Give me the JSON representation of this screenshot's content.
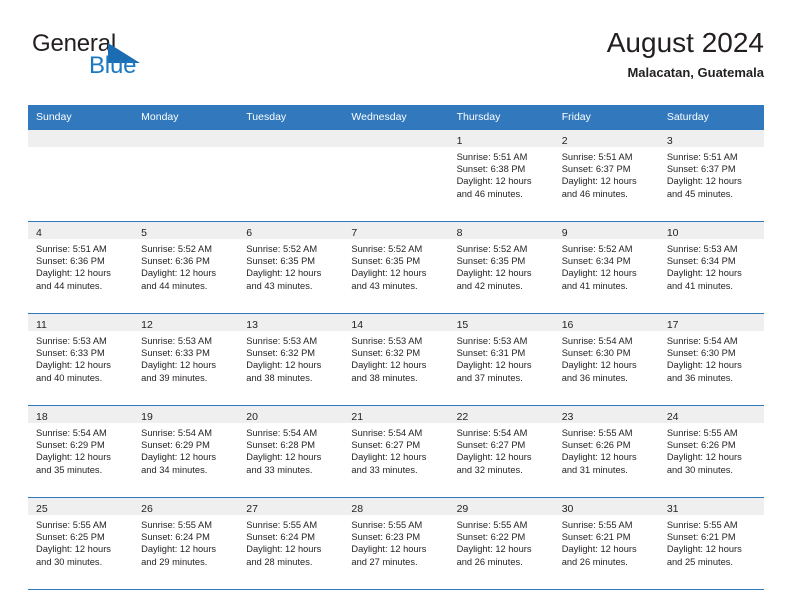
{
  "brand": {
    "name_part1": "General",
    "name_part2": "Blue",
    "triangle_color": "#1b6cb0",
    "blue_color": "#1b79c3"
  },
  "header": {
    "title": "August 2024",
    "subtitle": "Malacatan, Guatemala",
    "accent_color": "#3179bc",
    "daynum_band_color": "#efefef"
  },
  "weekdays": [
    "Sunday",
    "Monday",
    "Tuesday",
    "Wednesday",
    "Thursday",
    "Friday",
    "Saturday"
  ],
  "weeks": [
    [
      {
        "day": "",
        "sunrise": "",
        "sunset": "",
        "daylight1": "",
        "daylight2": ""
      },
      {
        "day": "",
        "sunrise": "",
        "sunset": "",
        "daylight1": "",
        "daylight2": ""
      },
      {
        "day": "",
        "sunrise": "",
        "sunset": "",
        "daylight1": "",
        "daylight2": ""
      },
      {
        "day": "",
        "sunrise": "",
        "sunset": "",
        "daylight1": "",
        "daylight2": ""
      },
      {
        "day": "1",
        "sunrise": "Sunrise: 5:51 AM",
        "sunset": "Sunset: 6:38 PM",
        "daylight1": "Daylight: 12 hours",
        "daylight2": "and 46 minutes."
      },
      {
        "day": "2",
        "sunrise": "Sunrise: 5:51 AM",
        "sunset": "Sunset: 6:37 PM",
        "daylight1": "Daylight: 12 hours",
        "daylight2": "and 46 minutes."
      },
      {
        "day": "3",
        "sunrise": "Sunrise: 5:51 AM",
        "sunset": "Sunset: 6:37 PM",
        "daylight1": "Daylight: 12 hours",
        "daylight2": "and 45 minutes."
      }
    ],
    [
      {
        "day": "4",
        "sunrise": "Sunrise: 5:51 AM",
        "sunset": "Sunset: 6:36 PM",
        "daylight1": "Daylight: 12 hours",
        "daylight2": "and 44 minutes."
      },
      {
        "day": "5",
        "sunrise": "Sunrise: 5:52 AM",
        "sunset": "Sunset: 6:36 PM",
        "daylight1": "Daylight: 12 hours",
        "daylight2": "and 44 minutes."
      },
      {
        "day": "6",
        "sunrise": "Sunrise: 5:52 AM",
        "sunset": "Sunset: 6:35 PM",
        "daylight1": "Daylight: 12 hours",
        "daylight2": "and 43 minutes."
      },
      {
        "day": "7",
        "sunrise": "Sunrise: 5:52 AM",
        "sunset": "Sunset: 6:35 PM",
        "daylight1": "Daylight: 12 hours",
        "daylight2": "and 43 minutes."
      },
      {
        "day": "8",
        "sunrise": "Sunrise: 5:52 AM",
        "sunset": "Sunset: 6:35 PM",
        "daylight1": "Daylight: 12 hours",
        "daylight2": "and 42 minutes."
      },
      {
        "day": "9",
        "sunrise": "Sunrise: 5:52 AM",
        "sunset": "Sunset: 6:34 PM",
        "daylight1": "Daylight: 12 hours",
        "daylight2": "and 41 minutes."
      },
      {
        "day": "10",
        "sunrise": "Sunrise: 5:53 AM",
        "sunset": "Sunset: 6:34 PM",
        "daylight1": "Daylight: 12 hours",
        "daylight2": "and 41 minutes."
      }
    ],
    [
      {
        "day": "11",
        "sunrise": "Sunrise: 5:53 AM",
        "sunset": "Sunset: 6:33 PM",
        "daylight1": "Daylight: 12 hours",
        "daylight2": "and 40 minutes."
      },
      {
        "day": "12",
        "sunrise": "Sunrise: 5:53 AM",
        "sunset": "Sunset: 6:33 PM",
        "daylight1": "Daylight: 12 hours",
        "daylight2": "and 39 minutes."
      },
      {
        "day": "13",
        "sunrise": "Sunrise: 5:53 AM",
        "sunset": "Sunset: 6:32 PM",
        "daylight1": "Daylight: 12 hours",
        "daylight2": "and 38 minutes."
      },
      {
        "day": "14",
        "sunrise": "Sunrise: 5:53 AM",
        "sunset": "Sunset: 6:32 PM",
        "daylight1": "Daylight: 12 hours",
        "daylight2": "and 38 minutes."
      },
      {
        "day": "15",
        "sunrise": "Sunrise: 5:53 AM",
        "sunset": "Sunset: 6:31 PM",
        "daylight1": "Daylight: 12 hours",
        "daylight2": "and 37 minutes."
      },
      {
        "day": "16",
        "sunrise": "Sunrise: 5:54 AM",
        "sunset": "Sunset: 6:30 PM",
        "daylight1": "Daylight: 12 hours",
        "daylight2": "and 36 minutes."
      },
      {
        "day": "17",
        "sunrise": "Sunrise: 5:54 AM",
        "sunset": "Sunset: 6:30 PM",
        "daylight1": "Daylight: 12 hours",
        "daylight2": "and 36 minutes."
      }
    ],
    [
      {
        "day": "18",
        "sunrise": "Sunrise: 5:54 AM",
        "sunset": "Sunset: 6:29 PM",
        "daylight1": "Daylight: 12 hours",
        "daylight2": "and 35 minutes."
      },
      {
        "day": "19",
        "sunrise": "Sunrise: 5:54 AM",
        "sunset": "Sunset: 6:29 PM",
        "daylight1": "Daylight: 12 hours",
        "daylight2": "and 34 minutes."
      },
      {
        "day": "20",
        "sunrise": "Sunrise: 5:54 AM",
        "sunset": "Sunset: 6:28 PM",
        "daylight1": "Daylight: 12 hours",
        "daylight2": "and 33 minutes."
      },
      {
        "day": "21",
        "sunrise": "Sunrise: 5:54 AM",
        "sunset": "Sunset: 6:27 PM",
        "daylight1": "Daylight: 12 hours",
        "daylight2": "and 33 minutes."
      },
      {
        "day": "22",
        "sunrise": "Sunrise: 5:54 AM",
        "sunset": "Sunset: 6:27 PM",
        "daylight1": "Daylight: 12 hours",
        "daylight2": "and 32 minutes."
      },
      {
        "day": "23",
        "sunrise": "Sunrise: 5:55 AM",
        "sunset": "Sunset: 6:26 PM",
        "daylight1": "Daylight: 12 hours",
        "daylight2": "and 31 minutes."
      },
      {
        "day": "24",
        "sunrise": "Sunrise: 5:55 AM",
        "sunset": "Sunset: 6:26 PM",
        "daylight1": "Daylight: 12 hours",
        "daylight2": "and 30 minutes."
      }
    ],
    [
      {
        "day": "25",
        "sunrise": "Sunrise: 5:55 AM",
        "sunset": "Sunset: 6:25 PM",
        "daylight1": "Daylight: 12 hours",
        "daylight2": "and 30 minutes."
      },
      {
        "day": "26",
        "sunrise": "Sunrise: 5:55 AM",
        "sunset": "Sunset: 6:24 PM",
        "daylight1": "Daylight: 12 hours",
        "daylight2": "and 29 minutes."
      },
      {
        "day": "27",
        "sunrise": "Sunrise: 5:55 AM",
        "sunset": "Sunset: 6:24 PM",
        "daylight1": "Daylight: 12 hours",
        "daylight2": "and 28 minutes."
      },
      {
        "day": "28",
        "sunrise": "Sunrise: 5:55 AM",
        "sunset": "Sunset: 6:23 PM",
        "daylight1": "Daylight: 12 hours",
        "daylight2": "and 27 minutes."
      },
      {
        "day": "29",
        "sunrise": "Sunrise: 5:55 AM",
        "sunset": "Sunset: 6:22 PM",
        "daylight1": "Daylight: 12 hours",
        "daylight2": "and 26 minutes."
      },
      {
        "day": "30",
        "sunrise": "Sunrise: 5:55 AM",
        "sunset": "Sunset: 6:21 PM",
        "daylight1": "Daylight: 12 hours",
        "daylight2": "and 26 minutes."
      },
      {
        "day": "31",
        "sunrise": "Sunrise: 5:55 AM",
        "sunset": "Sunset: 6:21 PM",
        "daylight1": "Daylight: 12 hours",
        "daylight2": "and 25 minutes."
      }
    ]
  ]
}
